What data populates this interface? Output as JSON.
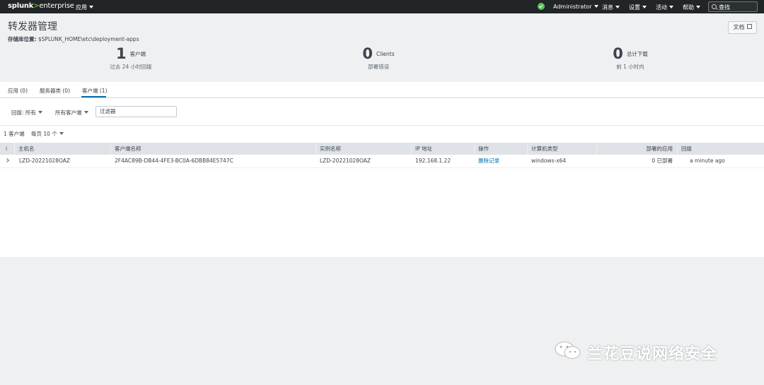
{
  "header": {
    "logo": {
      "splunk": "splunk",
      "gt": ">",
      "enterprise": "enterprise"
    },
    "apps_menu": "应用",
    "user_menu": "Administrator",
    "messages_menu": "消息",
    "settings_menu": "设置",
    "activity_menu": "活动",
    "help_menu": "帮助",
    "search_label": "查找"
  },
  "page": {
    "title": "转发器管理",
    "repo_label": "存储库位置:",
    "repo_path": "$SPLUNK_HOME\\etc\\deployment-apps",
    "doc_button": "文档"
  },
  "stats": [
    {
      "value": "1",
      "label": "客户端",
      "sub": "过去 24 小时回拨"
    },
    {
      "value": "0",
      "label": "Clients",
      "sub": "部署错误"
    },
    {
      "value": "0",
      "label": "总计下载",
      "sub": "前 1 小时内"
    }
  ],
  "tabs": [
    {
      "label": "应用 (0)"
    },
    {
      "label": "服务器类 (0)"
    },
    {
      "label": "客户端 (1)"
    }
  ],
  "filters": {
    "phonehome": "回拨: 所有",
    "clients": "所有客户端",
    "filter_placeholder": "过滤器"
  },
  "list": {
    "count": "1 客户端",
    "per_page": "每页 10 个",
    "columns": {
      "info": "i",
      "host": "主机名",
      "client_name": "客户端名称",
      "instance": "实例名称",
      "ip": "IP 地址",
      "action": "操作",
      "machine_type": "计算机类型",
      "deployed_apps": "部署的应用",
      "phonehome": "回拨"
    },
    "rows": [
      {
        "host": "LZD-20221028OAZ",
        "client_name": "2F4AC89B-DB44-4FE3-BC0A-6DBB84E5747C",
        "instance": "LZD-20221028OAZ",
        "ip": "192.168.1.22",
        "action": "删除记录",
        "machine_type": "windows-x64",
        "deployed": "0 已部署",
        "phonehome": "a minute ago"
      }
    ]
  },
  "watermark": {
    "text": "兰花豆说网络安全"
  },
  "colors": {
    "topbar": "#212527",
    "accent": "#006eaa",
    "ok": "#5cc05c",
    "splunk_green": "#65a637"
  }
}
